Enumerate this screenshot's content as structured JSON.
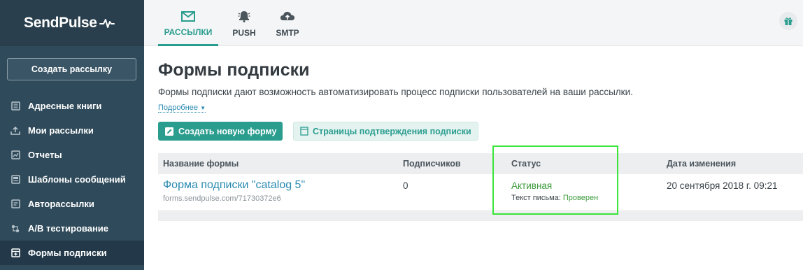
{
  "brand": {
    "name": "SendPulse"
  },
  "sidebar": {
    "create_button": "Создать рассылку",
    "items": [
      {
        "label": "Адресные книги",
        "icon": "address-book-icon"
      },
      {
        "label": "Мои рассылки",
        "icon": "upload-icon"
      },
      {
        "label": "Отчеты",
        "icon": "chart-icon"
      },
      {
        "label": "Шаблоны сообщений",
        "icon": "template-icon"
      },
      {
        "label": "Авторассылки",
        "icon": "autoresponder-icon"
      },
      {
        "label": "A/B тестирование",
        "icon": "ab-test-icon"
      },
      {
        "label": "Формы подписки",
        "icon": "form-icon",
        "active": true
      }
    ]
  },
  "topbar": {
    "tabs": [
      {
        "label": "РАССЫЛКИ",
        "icon": "envelope-icon",
        "active": true
      },
      {
        "label": "PUSH",
        "icon": "bell-icon"
      },
      {
        "label": "SMTP",
        "icon": "cloud-upload-icon"
      }
    ],
    "gift_icon": "gift-icon"
  },
  "main": {
    "title": "Формы подписки",
    "description": "Формы подписки дают возможность автоматизировать процесс подписки пользователей на ваши рассылки.",
    "more_link": "Подробнее",
    "create_form_button": "Создать новую форму",
    "confirm_pages_button": "Страницы подтверждения подписки"
  },
  "table": {
    "headers": {
      "name": "Название формы",
      "subscribers": "Подписчиков",
      "status": "Статус",
      "date": "Дата изменения"
    },
    "rows": [
      {
        "name": "Форма подписки \"catalog 5\"",
        "url": "forms.sendpulse.com/71730372e6",
        "subscribers": "0",
        "status": "Активная",
        "letter_label": "Текст письма:",
        "letter_status": "Проверен",
        "date": "20 сентября 2018 г. 09:21"
      }
    ]
  },
  "colors": {
    "accent": "#2a9d8f",
    "sidebar": "#2f4a5a",
    "link": "#2a8bb0",
    "status_green": "#3d9a3d",
    "highlight": "#3be53b"
  }
}
